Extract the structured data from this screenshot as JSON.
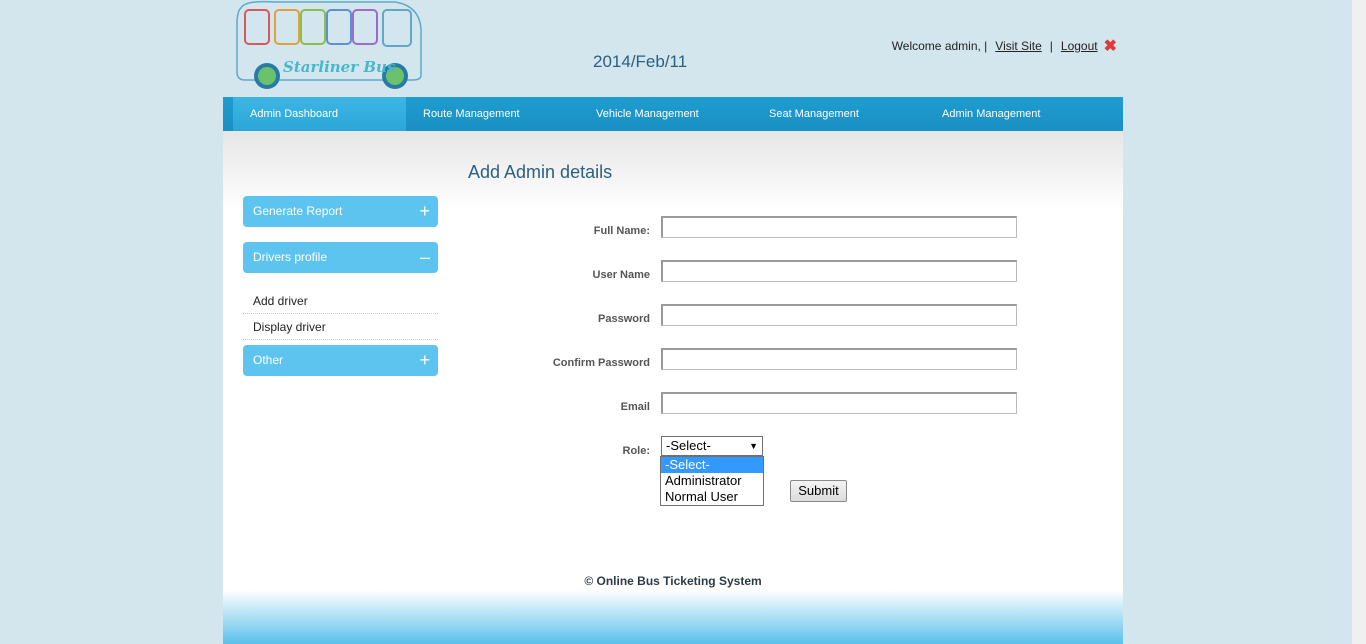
{
  "header": {
    "logo_text": "Starliner Bus",
    "date": "2014/Feb/11",
    "welcome": "Welcome admin, |",
    "visit_site": "Visit Site",
    "separator": "|",
    "logout": "Logout"
  },
  "nav": {
    "items": [
      {
        "label": "Admin Dashboard"
      },
      {
        "label": "Route Management"
      },
      {
        "label": "Vehicle Management"
      },
      {
        "label": "Seat Management"
      },
      {
        "label": "Admin Management"
      }
    ]
  },
  "sidebar": {
    "sections": [
      {
        "label": "Generate Report",
        "sign": "+"
      },
      {
        "label": "Drivers profile",
        "sign": "–"
      },
      {
        "label": "Other",
        "sign": "+"
      }
    ],
    "driver_items": [
      {
        "label": "Add driver"
      },
      {
        "label": "Display driver"
      }
    ]
  },
  "form": {
    "title": "Add Admin details",
    "fields": [
      {
        "label": "Full Name:",
        "value": ""
      },
      {
        "label": "User Name",
        "value": ""
      },
      {
        "label": "Password",
        "value": ""
      },
      {
        "label": "Confirm Password",
        "value": ""
      },
      {
        "label": "Email",
        "value": ""
      }
    ],
    "role_label": "Role:",
    "role_selected": "-Select-",
    "role_options": [
      "-Select-",
      "Administrator",
      "Normal User"
    ],
    "submit_label": "Submit"
  },
  "footer": {
    "copyright": "© Online Bus Ticketing System"
  },
  "colors": {
    "nav": "#1a8fc3",
    "accordion": "#5cc4ef",
    "page_bg": "#d3e6ee",
    "logout_icon": "#e03a3a"
  }
}
